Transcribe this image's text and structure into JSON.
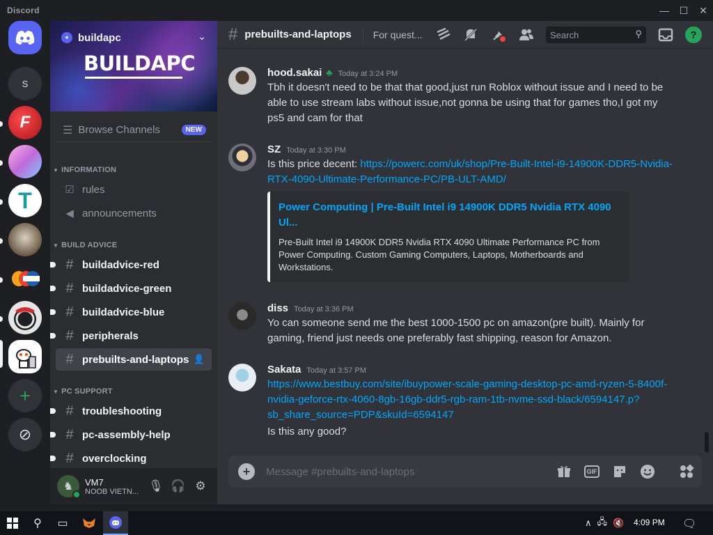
{
  "window": {
    "app_title": "Discord",
    "minimize": "—",
    "maximize": "☐",
    "close": "✕"
  },
  "servers": [
    {
      "name": "home",
      "icon": "discord-logo-icon"
    },
    {
      "name": "s-server",
      "letter": "S"
    },
    {
      "name": "red-f-server"
    },
    {
      "name": "anime-server"
    },
    {
      "name": "t-server"
    },
    {
      "name": "cat-server"
    },
    {
      "name": "newegg-server"
    },
    {
      "name": "obs-server"
    },
    {
      "name": "buildapc-server",
      "active": true
    },
    {
      "name": "add-server",
      "glyph": "+"
    },
    {
      "name": "discover",
      "glyph": "⊘"
    }
  ],
  "sidebar": {
    "server_name": "buildapc",
    "banner_word": "BUILDAPC",
    "browse_label": "Browse Channels",
    "new_badge": "NEW",
    "categories": [
      {
        "label": "INFORMATION",
        "channels": [
          "rules",
          "announcements"
        ]
      },
      {
        "label": "BUILD ADVICE",
        "channels": [
          "buildadvice-red",
          "buildadvice-green",
          "buildadvice-blue",
          "peripherals",
          "prebuilts-and-laptops"
        ]
      },
      {
        "label": "PC SUPPORT",
        "channels": [
          "troubleshooting",
          "pc-assembly-help",
          "overclocking"
        ]
      }
    ]
  },
  "user": {
    "name": "VM7",
    "status": "NOOB VIETN..."
  },
  "header": {
    "channel": "prebuilts-and-laptops",
    "topic": "For quest...",
    "search_placeholder": "Search",
    "help": "?"
  },
  "messages": [
    {
      "author": "hood.sakai",
      "badge": "♣",
      "time": "Today at 3:24 PM",
      "text": "Tbh it doesn't need to be that that good,just run Roblox without issue and I need to be able to use stream labs without issue,not gonna be using that for games tho,I got my ps5 and cam for that"
    },
    {
      "author": "SZ",
      "time": "Today at 3:30 PM",
      "text_prefix": "Is this price decent: ",
      "link": "https://powerc.com/uk/shop/Pre-Built-Intel-i9-14900K-DDR5-Nvidia-RTX-4090-Ultimate-Performance-PC/PB-ULT-AMD/",
      "embed_title": "Power Computing | Pre-Built Intel i9 14900K DDR5 Nvidia RTX 4090 Ul...",
      "embed_desc": "Pre-Built Intel i9 14900K DDR5 Nvidia RTX 4090 Ultimate Performance PC from Power Computing. Custom Gaming Computers, Laptops, Motherboards and Workstations."
    },
    {
      "author": "diss",
      "time": "Today at 3:36 PM",
      "text": "Yo can someone send me the best 1000-1500 pc on amazon(pre built). Mainly for gaming, friend just needs one preferably fast shipping, reason for Amazon."
    },
    {
      "author": "Sakata",
      "time": "Today at 3:57 PM",
      "link": "https://www.bestbuy.com/site/ibuypower-scale-gaming-desktop-pc-amd-ryzen-5-8400f-nvidia-geforce-rtx-4060-8gb-16gb-ddr5-rgb-ram-1tb-nvme-ssd-black/6594147.p?sb_share_source=PDP&skuId=6594147",
      "text": "Is this any good?"
    }
  ],
  "composer": {
    "placeholder": "Message #prebuilts-and-laptops",
    "gif": "GIF"
  },
  "taskbar": {
    "time": "4:09 PM"
  },
  "colors": {
    "blurple": "#5865f2",
    "link": "#00a8fc",
    "online": "#23a55a"
  }
}
